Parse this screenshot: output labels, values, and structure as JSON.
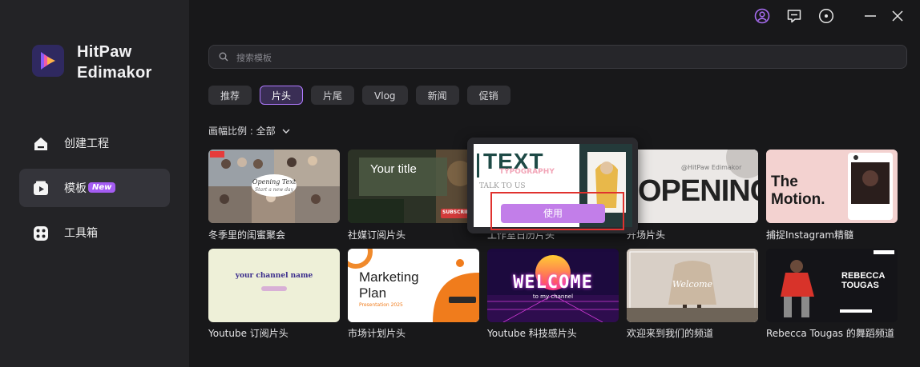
{
  "app": {
    "name_line1": "HitPaw",
    "name_line2": "Edimakor"
  },
  "sidebar": {
    "items": [
      {
        "label": "创建工程",
        "icon": "home-icon"
      },
      {
        "label": "模板",
        "icon": "template-icon",
        "badge": "New"
      },
      {
        "label": "工具箱",
        "icon": "toolbox-icon"
      }
    ]
  },
  "topbar": {
    "icons": [
      "account-icon",
      "feedback-icon",
      "settings-icon",
      "minimize-icon",
      "close-icon"
    ]
  },
  "search": {
    "placeholder": "搜索模板"
  },
  "tabs": [
    "推荐",
    "片头",
    "片尾",
    "Vlog",
    "新闻",
    "促销"
  ],
  "active_tab": "片头",
  "filter": {
    "label": "画幅比例 : 全部"
  },
  "popup": {
    "use_label": "使用",
    "thumb_text": "TEXT",
    "thumb_sub": "TYPOGRAPHY",
    "thumb_talk": "TALK TO US"
  },
  "templates": [
    {
      "caption": "冬季里的闺蜜聚会",
      "thumb_text": "Opening Text",
      "thumb_sub": "Start a new day"
    },
    {
      "caption": "社媒订阅片头",
      "thumb_text": "Your title",
      "thumb_sub": "SUBSCRIBE"
    },
    {
      "caption": "工作室日历片头"
    },
    {
      "caption": "开场片头",
      "thumb_text": "OPENING",
      "thumb_sub": "@HitPaw Edimakor"
    },
    {
      "caption": "捕捉Instagram精髓",
      "thumb_text": "The Motion."
    },
    {
      "caption": "Youtube 订阅片头",
      "thumb_text": "your channel name"
    },
    {
      "caption": "市场计划片头",
      "thumb_text": "Marketing Plan",
      "thumb_sub": "Presentation 2025"
    },
    {
      "caption": "Youtube 科技感片头",
      "thumb_text": "WELCOME",
      "thumb_sub": "to my channel"
    },
    {
      "caption": "欢迎来到我们的频道",
      "thumb_text": "Welcome"
    },
    {
      "caption": "Rebecca Tougas 的舞蹈频道",
      "thumb_text": "REBECCA TOUGAS"
    }
  ],
  "colors": {
    "accent": "#b07aff",
    "use_button": "#c27ee9",
    "highlight": "#e0322e"
  }
}
